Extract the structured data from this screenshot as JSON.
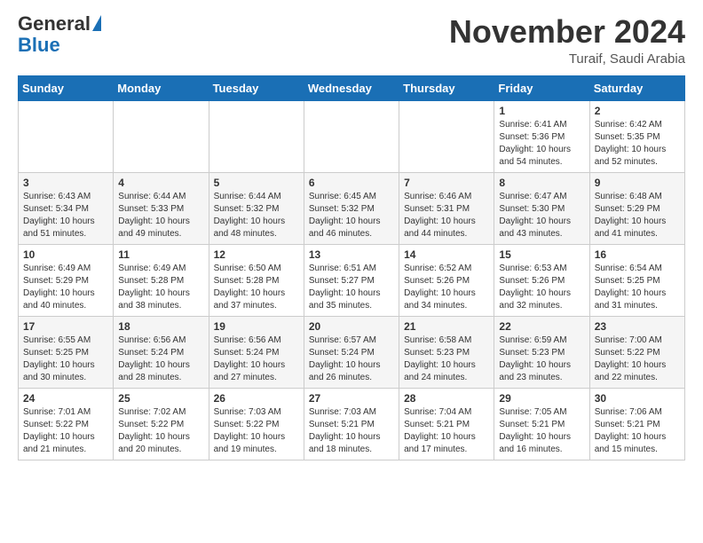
{
  "header": {
    "logo_general": "General",
    "logo_blue": "Blue",
    "month_title": "November 2024",
    "subtitle": "Turaif, Saudi Arabia"
  },
  "days_of_week": [
    "Sunday",
    "Monday",
    "Tuesday",
    "Wednesday",
    "Thursday",
    "Friday",
    "Saturday"
  ],
  "weeks": [
    [
      {
        "day": "",
        "info": ""
      },
      {
        "day": "",
        "info": ""
      },
      {
        "day": "",
        "info": ""
      },
      {
        "day": "",
        "info": ""
      },
      {
        "day": "",
        "info": ""
      },
      {
        "day": "1",
        "info": "Sunrise: 6:41 AM\nSunset: 5:36 PM\nDaylight: 10 hours and 54 minutes."
      },
      {
        "day": "2",
        "info": "Sunrise: 6:42 AM\nSunset: 5:35 PM\nDaylight: 10 hours and 52 minutes."
      }
    ],
    [
      {
        "day": "3",
        "info": "Sunrise: 6:43 AM\nSunset: 5:34 PM\nDaylight: 10 hours and 51 minutes."
      },
      {
        "day": "4",
        "info": "Sunrise: 6:44 AM\nSunset: 5:33 PM\nDaylight: 10 hours and 49 minutes."
      },
      {
        "day": "5",
        "info": "Sunrise: 6:44 AM\nSunset: 5:32 PM\nDaylight: 10 hours and 48 minutes."
      },
      {
        "day": "6",
        "info": "Sunrise: 6:45 AM\nSunset: 5:32 PM\nDaylight: 10 hours and 46 minutes."
      },
      {
        "day": "7",
        "info": "Sunrise: 6:46 AM\nSunset: 5:31 PM\nDaylight: 10 hours and 44 minutes."
      },
      {
        "day": "8",
        "info": "Sunrise: 6:47 AM\nSunset: 5:30 PM\nDaylight: 10 hours and 43 minutes."
      },
      {
        "day": "9",
        "info": "Sunrise: 6:48 AM\nSunset: 5:29 PM\nDaylight: 10 hours and 41 minutes."
      }
    ],
    [
      {
        "day": "10",
        "info": "Sunrise: 6:49 AM\nSunset: 5:29 PM\nDaylight: 10 hours and 40 minutes."
      },
      {
        "day": "11",
        "info": "Sunrise: 6:49 AM\nSunset: 5:28 PM\nDaylight: 10 hours and 38 minutes."
      },
      {
        "day": "12",
        "info": "Sunrise: 6:50 AM\nSunset: 5:28 PM\nDaylight: 10 hours and 37 minutes."
      },
      {
        "day": "13",
        "info": "Sunrise: 6:51 AM\nSunset: 5:27 PM\nDaylight: 10 hours and 35 minutes."
      },
      {
        "day": "14",
        "info": "Sunrise: 6:52 AM\nSunset: 5:26 PM\nDaylight: 10 hours and 34 minutes."
      },
      {
        "day": "15",
        "info": "Sunrise: 6:53 AM\nSunset: 5:26 PM\nDaylight: 10 hours and 32 minutes."
      },
      {
        "day": "16",
        "info": "Sunrise: 6:54 AM\nSunset: 5:25 PM\nDaylight: 10 hours and 31 minutes."
      }
    ],
    [
      {
        "day": "17",
        "info": "Sunrise: 6:55 AM\nSunset: 5:25 PM\nDaylight: 10 hours and 30 minutes."
      },
      {
        "day": "18",
        "info": "Sunrise: 6:56 AM\nSunset: 5:24 PM\nDaylight: 10 hours and 28 minutes."
      },
      {
        "day": "19",
        "info": "Sunrise: 6:56 AM\nSunset: 5:24 PM\nDaylight: 10 hours and 27 minutes."
      },
      {
        "day": "20",
        "info": "Sunrise: 6:57 AM\nSunset: 5:24 PM\nDaylight: 10 hours and 26 minutes."
      },
      {
        "day": "21",
        "info": "Sunrise: 6:58 AM\nSunset: 5:23 PM\nDaylight: 10 hours and 24 minutes."
      },
      {
        "day": "22",
        "info": "Sunrise: 6:59 AM\nSunset: 5:23 PM\nDaylight: 10 hours and 23 minutes."
      },
      {
        "day": "23",
        "info": "Sunrise: 7:00 AM\nSunset: 5:22 PM\nDaylight: 10 hours and 22 minutes."
      }
    ],
    [
      {
        "day": "24",
        "info": "Sunrise: 7:01 AM\nSunset: 5:22 PM\nDaylight: 10 hours and 21 minutes."
      },
      {
        "day": "25",
        "info": "Sunrise: 7:02 AM\nSunset: 5:22 PM\nDaylight: 10 hours and 20 minutes."
      },
      {
        "day": "26",
        "info": "Sunrise: 7:03 AM\nSunset: 5:22 PM\nDaylight: 10 hours and 19 minutes."
      },
      {
        "day": "27",
        "info": "Sunrise: 7:03 AM\nSunset: 5:21 PM\nDaylight: 10 hours and 18 minutes."
      },
      {
        "day": "28",
        "info": "Sunrise: 7:04 AM\nSunset: 5:21 PM\nDaylight: 10 hours and 17 minutes."
      },
      {
        "day": "29",
        "info": "Sunrise: 7:05 AM\nSunset: 5:21 PM\nDaylight: 10 hours and 16 minutes."
      },
      {
        "day": "30",
        "info": "Sunrise: 7:06 AM\nSunset: 5:21 PM\nDaylight: 10 hours and 15 minutes."
      }
    ]
  ]
}
